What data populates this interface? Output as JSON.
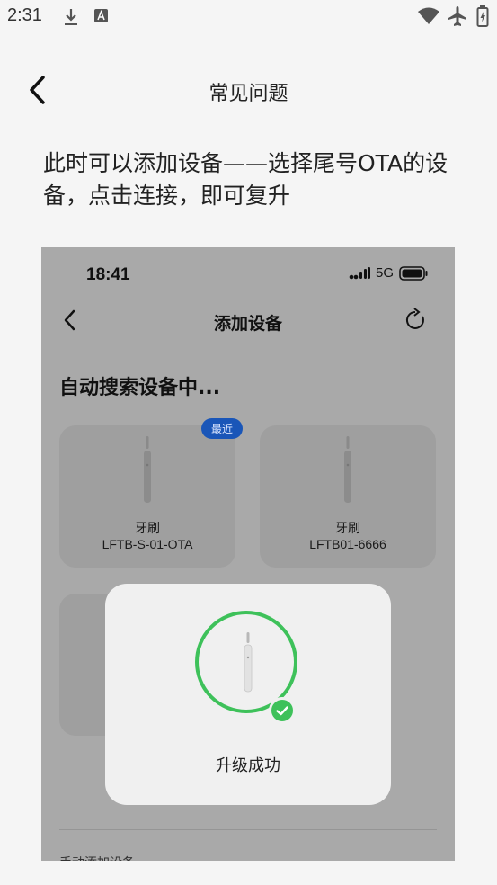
{
  "status_bar": {
    "time": "2:31",
    "left_icons": [
      "download-icon",
      "font-a-icon"
    ],
    "right_icons": [
      "wifi-icon",
      "airplane-icon",
      "battery-icon"
    ]
  },
  "header": {
    "back_icon": "chevron-left-icon",
    "title": "常见问题"
  },
  "description": "此时可以添加设备——选择尾号OTA的设备，点击连接，即可复升",
  "screenshot": {
    "status_time": "18:41",
    "network": "5G",
    "title": "添加设备",
    "back_icon": "chevron-left-icon",
    "refresh_icon": "refresh-icon",
    "searching_text": "自动搜索设备中...",
    "devices": [
      {
        "name": "牙刷",
        "model": "LFTB-S-01-OTA",
        "badge": "最近"
      },
      {
        "name": "牙刷",
        "model": "LFTB01-6666"
      }
    ],
    "partial_text": "手动添加设备",
    "dialog": {
      "message": "升级成功",
      "accent_color": "#3ec15a"
    }
  }
}
